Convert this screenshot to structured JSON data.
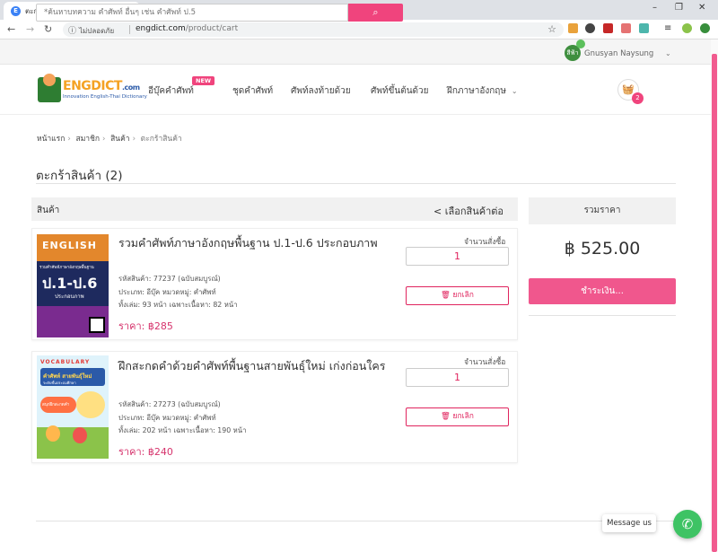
{
  "browser": {
    "tab_title": "ตะกร้าสินค้า",
    "tab_favicon": "E",
    "security_label": "ไม่ปลอดภัย",
    "url_domain": "engdict.com",
    "url_path": "/product/cart"
  },
  "topbar": {
    "search_placeholder": "*ค้นหาบทความ คำศัพท์ อื่นๆ เช่น คำศัพท์ ป.5",
    "search_button_icon": "search-icon",
    "user_name": "Gnusyan Naysung",
    "avatar_text": "สีฟ้า"
  },
  "nav": {
    "logo_text_1": "ENGDICT",
    "logo_text_2": ".com",
    "logo_subtitle": "Innovation English-Thai Dictionary",
    "items": [
      {
        "label": "อีบุ๊คคำศัพท์"
      },
      {
        "label": "ชุดคำศัพท์"
      },
      {
        "label": "ศัพท์ลงท้ายด้วย"
      },
      {
        "label": "ศัพท์ขึ้นต้นด้วย"
      },
      {
        "label": "ฝึกภาษาอังกฤษ"
      }
    ],
    "new_badge": "NEW",
    "cart_count": "2"
  },
  "breadcrumb": [
    "หน้าแรก",
    "สมาชิก",
    "สินค้า",
    "ตะกร้าสินค้า"
  ],
  "page_title": "ตะกร้าสินค้า (2)",
  "list": {
    "header_label": "สินค้า",
    "continue_link": "< เลือกสินค้าต่อ",
    "qty_label": "จำนวนสั่งซื้อ",
    "delete_label": "ยกเลิก",
    "items": [
      {
        "title": "รวมคำศัพท์ภาษาอังกฤษพื้นฐาน ป.1-ป.6 ประกอบภาพ",
        "code": "รหัสสินค้า: 77237 (ฉบับสมบูรณ์)",
        "type": "ประเภท: อีบุ๊ค หมวดหมู่: คำศัพท์",
        "pages": "ทั้งเล่ม: 93 หน้า เฉพาะเนื้อหา: 82 หน้า",
        "price": "ราคา: ฿285",
        "qty": "1",
        "cover_heading": "ENGLISH",
        "cover_subtitle": "รวมคำศัพท์ภาษาอังกฤษพื้นฐาน",
        "cover_grade": "ป.1-ป.6",
        "cover_caption": "ประกอบภาพ"
      },
      {
        "title": "ฝึกสะกดคำด้วยคำศัพท์พื้นฐานสายพันธุ์ใหม่ เก่งก่อนใคร",
        "code": "รหัสสินค้า: 27273 (ฉบับสมบูรณ์)",
        "type": "ประเภท: อีบุ๊ค หมวดหมู่: คำศัพท์",
        "pages": "ทั้งเล่ม: 202 หน้า เฉพาะเนื้อหา: 190 หน้า",
        "price": "ราคา: ฿240",
        "qty": "1",
        "cover_heading": "VOCABULARY",
        "cover_line1": "คำศัพท์ สายพันธุ์ใหม่",
        "cover_line2": "ระดับชั้นประถมศึกษา",
        "cover_line3": "สนุกฝึกสะกดคำ"
      }
    ]
  },
  "summary": {
    "header": "รวมราคา",
    "total": "฿ 525.00",
    "pay_button": "ชำระเงิน..."
  },
  "chat": {
    "message_label": "Message us"
  },
  "colors": {
    "accent": "#f0447d",
    "price": "#d6336c",
    "chat": "#3ec364"
  }
}
